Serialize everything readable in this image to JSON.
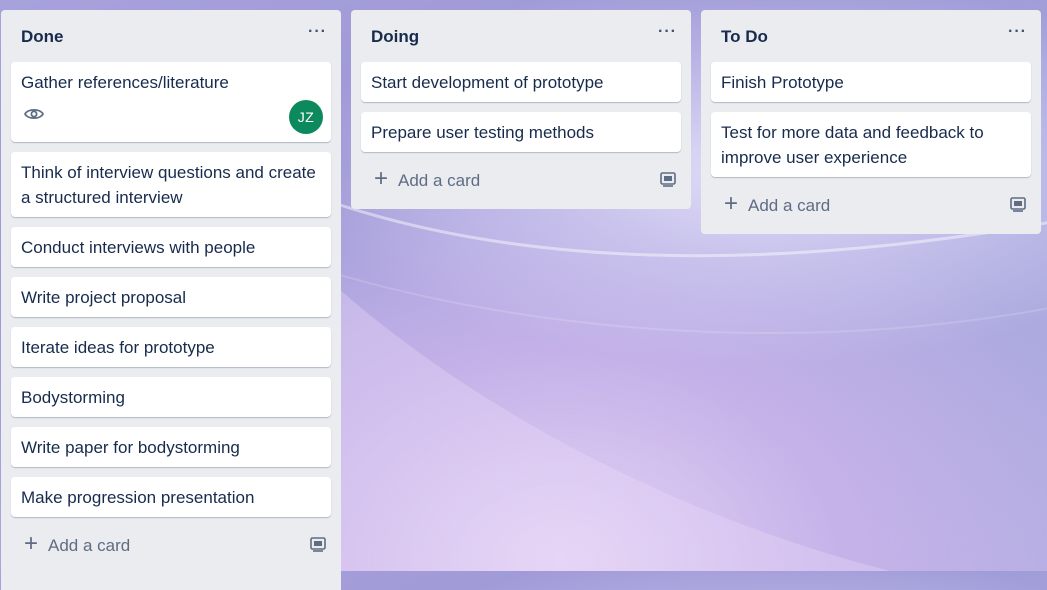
{
  "board": {
    "lists": [
      {
        "title": "Done",
        "cards": [
          "Gather references/literature",
          "Think of interview questions and create a structured interview",
          "Conduct interviews with people",
          "Write project proposal",
          "Iterate ideas for prototype",
          "Bodystorming",
          "Write paper for bodystorming",
          "Make progression presentation"
        ],
        "first_card_avatar": "JZ",
        "add_card_label": "Add a card"
      },
      {
        "title": "Doing",
        "cards": [
          "Start development of prototype",
          "Prepare user testing methods"
        ],
        "add_card_label": "Add a card"
      },
      {
        "title": "To Do",
        "cards": [
          "Finish Prototype",
          "Test for more data and feedback to improve user experience"
        ],
        "add_card_label": "Add a card"
      }
    ],
    "menu_glyph": "···",
    "add_glyph": "+",
    "icons": {
      "list_menu": "more-horizontal-icon",
      "watch": "eye-icon",
      "add": "plus-icon",
      "template": "card-template-icon"
    },
    "colors": {
      "list_bg": "#ebecf0",
      "card_bg": "#ffffff",
      "text": "#172b4d",
      "muted": "#5e6c84",
      "avatar_bg": "#0d8a5d"
    }
  }
}
